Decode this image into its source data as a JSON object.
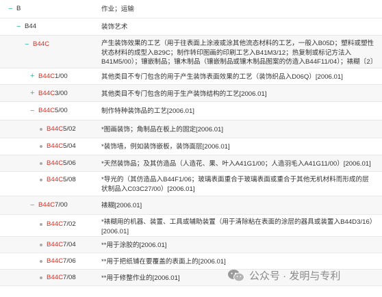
{
  "rows": [
    {
      "toggle": "−",
      "code_hl": "",
      "code_rest": "B",
      "desc": "作业；运输"
    },
    {
      "toggle": "−",
      "code_hl": "",
      "code_rest": "B44",
      "desc": "装饰艺术"
    },
    {
      "toggle": "−",
      "code_hl": "B44C",
      "code_rest": "",
      "desc": "产生装饰效果的工艺（用于往表面上涂液或涂其他流态材料的工艺，一般入B05D；塑料或塑性状态材料的成型入B29C；制作转印图画的印刷工艺入B41M3/12；热复制或标记方法入B41M5/00）；镶嵌制品；镶木制品（镶嵌制品或镶木制品图案的仿造入B44F11/04）；裱糊〔2〕"
    },
    {
      "toggle": "+",
      "code_hl": "B44C",
      "code_rest": "1/00",
      "desc": "其他类目不专门包含的用于产生装饰表面效果的工艺（装饰织品入D06Q）[2006.01]"
    },
    {
      "toggle": "+",
      "code_hl": "B44C",
      "code_rest": "3/00",
      "desc": "其他类目不专门包含的用于生产装饰结构的工艺[2006.01]"
    },
    {
      "toggle": "−",
      "code_hl": "B44C",
      "code_rest": "5/00",
      "desc": "制作特种装饰品的工艺[2006.01]"
    },
    {
      "toggle": "",
      "code_hl": "B44C",
      "code_rest": "5/02",
      "desc": "*图画装饰；角制品在板上的固定[2006.01]"
    },
    {
      "toggle": "",
      "code_hl": "B44C",
      "code_rest": "5/04",
      "desc": "*装饰墙，例如装饰嵌板，装饰面层[2006.01]"
    },
    {
      "toggle": "",
      "code_hl": "B44C",
      "code_rest": "5/06",
      "desc": "*天然装饰品；及其仿造品（人造花、果、叶入A41G1/00；人造羽毛入A41G11/00）[2006.01]"
    },
    {
      "toggle": "",
      "code_hl": "B44C",
      "code_rest": "5/08",
      "desc": "*导光的（其仿造品入B44F1/06；玻璃表面重合于玻璃表面或重合于其他无机材料而形成的层状制品入C03C27/00）[2006.01]"
    },
    {
      "toggle": "−",
      "code_hl": "B44C",
      "code_rest": "7/00",
      "desc": "裱糊[2006.01]"
    },
    {
      "toggle": "",
      "code_hl": "B44C",
      "code_rest": "7/02",
      "desc": "*裱糊用的机器、装置、工具或辅助装置（用于清除粘在表面的涂层的器具或装置入B44D3/16）[2006.01]"
    },
    {
      "toggle": "",
      "code_hl": "B44C",
      "code_rest": "7/04",
      "desc": "**用于涂胶的[2006.01]"
    },
    {
      "toggle": "",
      "code_hl": "B44C",
      "code_rest": "7/06",
      "desc": "**用于把纸铺在要覆盖的表面上的[2006.01]"
    },
    {
      "toggle": "",
      "code_hl": "B44C",
      "code_rest": "7/08",
      "desc": "**用于修整作业的[2006.01]"
    }
  ],
  "watermark": {
    "text": "公众号 · 发明与专利",
    "icon": "wechat-icon"
  },
  "colors": {
    "accent": "#2bb6a3",
    "code": "#e02b20",
    "row_alt": "#f7f7f7",
    "divider": "#e8e8e8"
  }
}
